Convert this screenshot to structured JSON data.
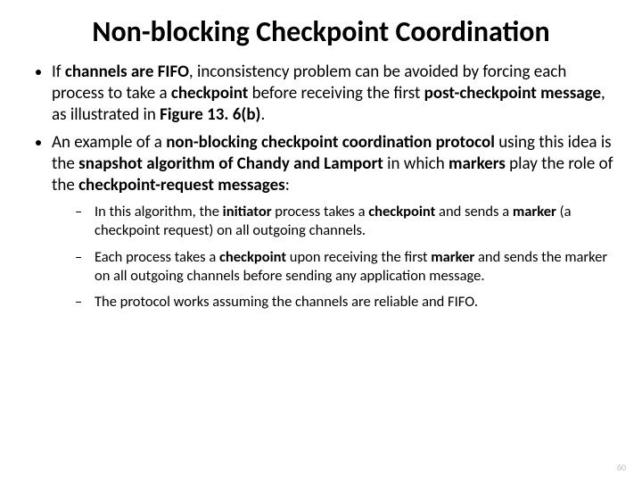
{
  "title": "Non-blocking Checkpoint Coordination",
  "b1": {
    "t1": "If ",
    "t2": "channels are FIFO",
    "t3": ", inconsistency problem can be avoided by forcing each process to take a ",
    "t4": "checkpoint",
    "t5": " before receiving the first ",
    "t6": "post-checkpoint message",
    "t7": ", as illustrated in ",
    "t8": "Figure 13. 6(b)",
    "t9": "."
  },
  "b2": {
    "t1": "An example of a ",
    "t2": "non-blocking checkpoint coordination protocol",
    "t3": " using this idea is the ",
    "t4": "snapshot algorithm of Chandy and Lamport",
    "t5": " in which ",
    "t6": "markers",
    "t7": " play the role of the ",
    "t8": "checkpoint-request messages",
    "t9": ":"
  },
  "s1": {
    "t1": "In this algorithm, the ",
    "t2": "initiator",
    "t3": " process takes a ",
    "t4": "checkpoint",
    "t5": " and sends a ",
    "t6": "marker",
    "t7": " (a checkpoint request) on all outgoing channels."
  },
  "s2": {
    "t1": "Each process takes a ",
    "t2": "checkpoint",
    "t3": " upon receiving the first ",
    "t4": "marker",
    "t5": " and sends the marker on all outgoing channels before sending any application message."
  },
  "s3": {
    "t1": "The protocol works assuming the channels are reliable and FIFO."
  },
  "pagenum": "60"
}
